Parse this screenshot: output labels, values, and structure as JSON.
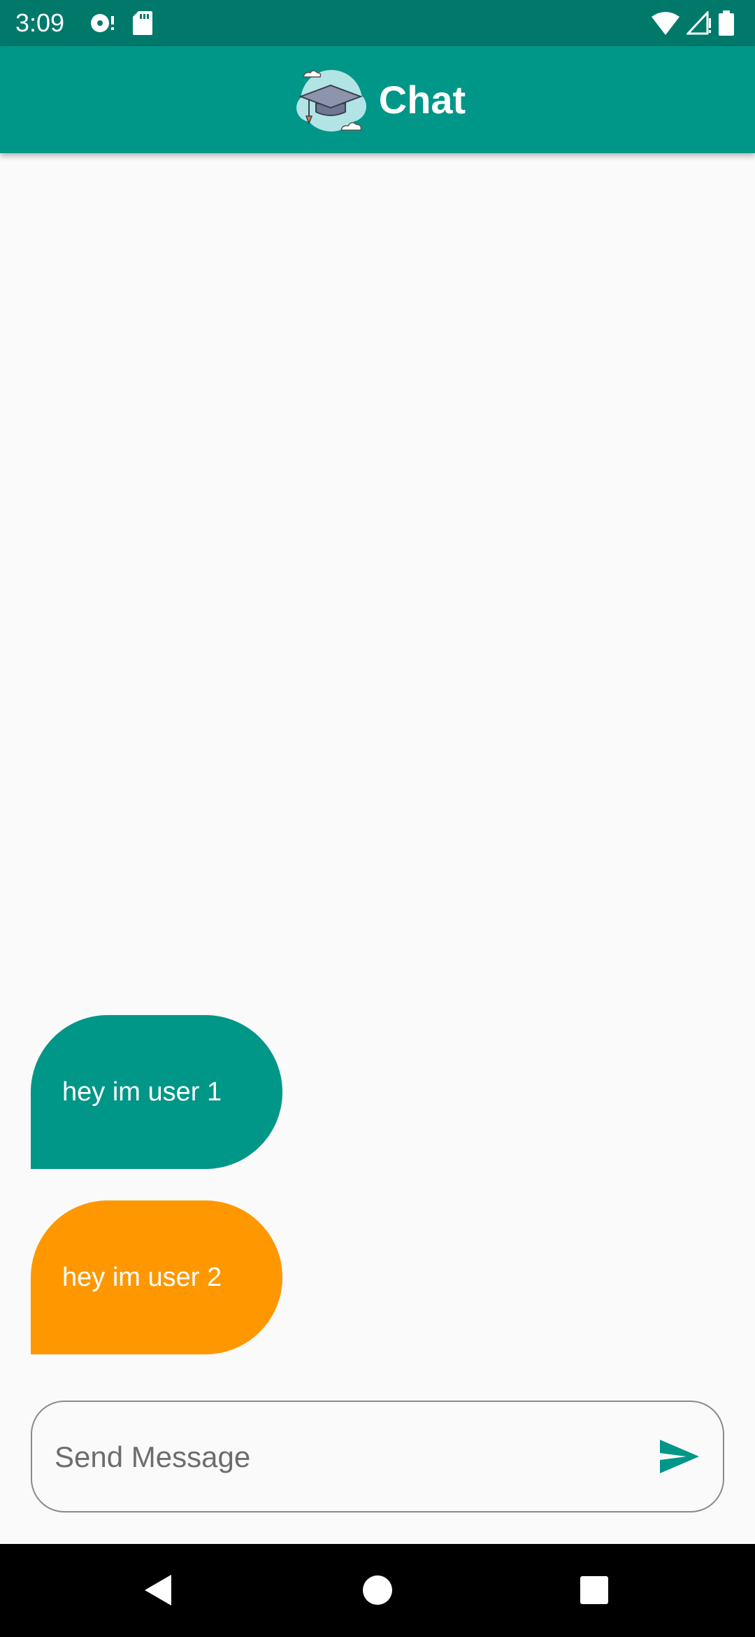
{
  "status_bar": {
    "time": "3:09",
    "left_icons": [
      "sync-disc-icon",
      "sd-card-icon"
    ],
    "right_icons": [
      "wifi-icon",
      "cellular-signal-icon",
      "battery-icon"
    ]
  },
  "app_bar": {
    "title": "Chat",
    "logo_icon": "graduation-cap-cloud-icon"
  },
  "messages": [
    {
      "sender": "user 1",
      "text": "hey im user 1",
      "color": "#009688"
    },
    {
      "sender": "user 2",
      "text": "hey im user 2",
      "color": "#ff9800"
    }
  ],
  "composer": {
    "placeholder": "Send Message",
    "value": "",
    "send_icon": "send-icon"
  },
  "nav_bar": {
    "buttons": [
      "back-icon",
      "home-icon",
      "recents-icon"
    ]
  },
  "colors": {
    "status_bar": "#00796b",
    "app_bar": "#009688",
    "accent": "#009688",
    "user2_bubble": "#ff9800",
    "background": "#fafafa"
  }
}
